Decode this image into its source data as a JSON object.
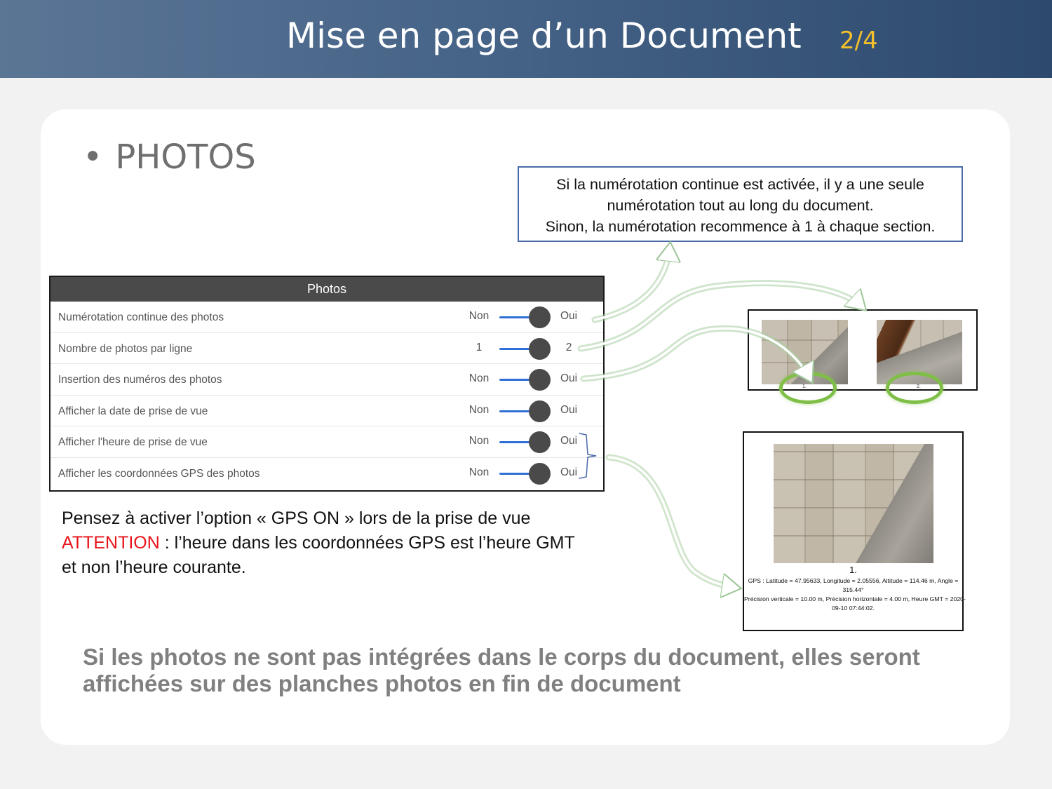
{
  "header": {
    "title": "Mise en page d’un Document",
    "page": "2/4"
  },
  "section": {
    "bullet": "•",
    "title": "PHOTOS"
  },
  "infobox": {
    "lines": [
      "Si la numérotation continue est activée, il y a une seule",
      "numérotation tout au long du document.",
      "Sinon, la numérotation recommence à 1 à chaque section."
    ]
  },
  "panel": {
    "title": "Photos",
    "rows": [
      {
        "label": "Numérotation continue des photos",
        "off": "Non",
        "on": "Oui",
        "state": "on"
      },
      {
        "label": "Nombre de photos par ligne",
        "off": "1",
        "on": "2",
        "state": "on"
      },
      {
        "label": "Insertion des numéros des photos",
        "off": "Non",
        "on": "Oui",
        "state": "on"
      },
      {
        "label": "Afficher la date de prise de vue",
        "off": "Non",
        "on": "Oui",
        "state": "on"
      },
      {
        "label": "Afficher l'heure de prise de vue",
        "off": "Non",
        "on": "Oui",
        "state": "on"
      },
      {
        "label": "Afficher les coordonnées GPS des photos",
        "off": "Non",
        "on": "Oui",
        "state": "on"
      }
    ]
  },
  "note": {
    "line1": "Pensez à activer l’option « GPS ON » lors de la prise de vue",
    "warn": "ATTENTION",
    "line2_rest": " : l’heure dans les coordonnées GPS est l’heure GMT",
    "line3": "et non l’heure courante."
  },
  "footer": {
    "line1": "Si les photos ne sont pas intégrées dans le corps du document, elles seront",
    "line2": "affichées sur des planches photos en fin de document"
  },
  "preview_top": {
    "label1": "1.",
    "label2": "2."
  },
  "preview_bottom": {
    "number": "1.",
    "gps_lines": [
      "GPS : Latitude = 47.95633, Longitude = 2.05556, Altitude = 114.46 m, Angle =",
      "315.44°",
      "Précision verticale = 10.00 m, Précision horizontale = 4.00 m, Heure GMT = 2020-",
      "09-10 07:44:02."
    ]
  },
  "colors": {
    "toggle_track": "#2f6fd6",
    "toggle_knob": "#4a4a4a",
    "warning": "#e8141b",
    "page_number": "#f5c12a",
    "highlight_circle": "#7fbf47"
  }
}
